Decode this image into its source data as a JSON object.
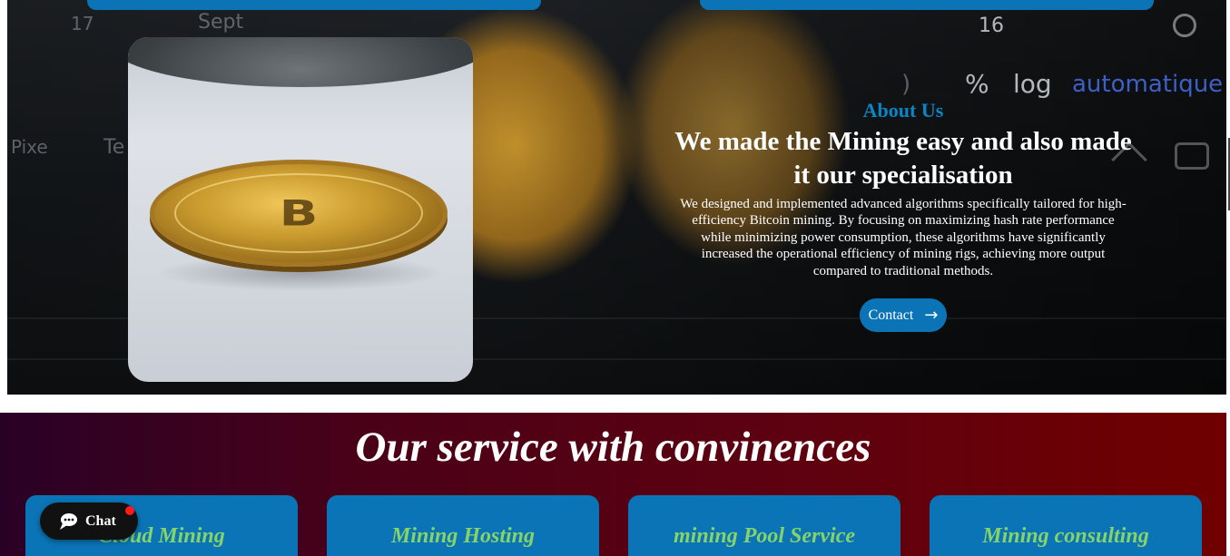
{
  "hero": {
    "screen_labels": {
      "num_17": "17",
      "sept": "Sept",
      "num_16": "16",
      "percent": "%",
      "log": "log",
      "automatique": "automatique",
      "paren": ")",
      "pixe": "Pixe",
      "te": "Te"
    },
    "about": {
      "label": "About Us",
      "heading": "We made the Mining easy and also made it our specialisation",
      "text": "We designed and implemented advanced algorithms specifically tailored for high-efficiency Bitcoin mining. By focusing on maximizing hash rate performance while minimizing power consumption, these algorithms have significantly increased the operational efficiency of mining rigs, achieving more output compared to traditional methods.",
      "button_label": "Contact",
      "button_icon": "arrow-right-icon"
    },
    "photo": {
      "coin_symbol": "B"
    }
  },
  "services": {
    "title": "Our service with convinences",
    "cards": [
      {
        "title": "Cloud Mining"
      },
      {
        "title": "Mining Hosting"
      },
      {
        "title": "mining Pool Service"
      },
      {
        "title": "Mining consulting"
      }
    ]
  },
  "chat": {
    "label": "Chat",
    "icon": "chat-bubble-icon"
  },
  "colors": {
    "accent_blue": "#0a74b6",
    "about_label": "#0a86c6",
    "service_title_green": "#86d36a",
    "services_gradient_start": "#2a0126",
    "services_gradient_end": "#700000"
  }
}
